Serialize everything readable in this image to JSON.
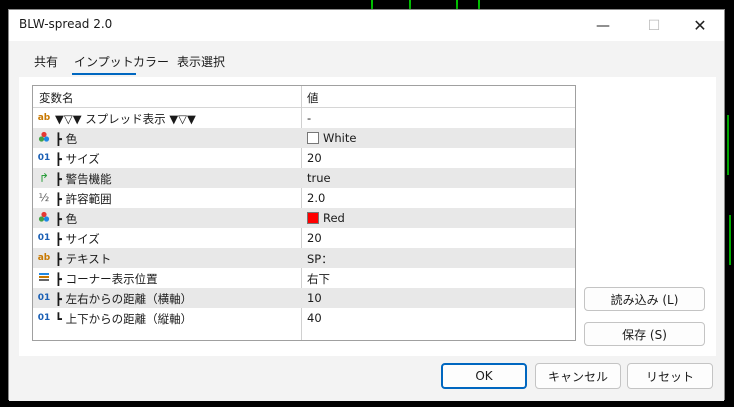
{
  "window": {
    "title": "BLW-spread 2.0",
    "minimize_glyph": "—",
    "maximize_glyph": "☐",
    "close_glyph": "✕"
  },
  "tabs": [
    {
      "label": "共有",
      "active": false
    },
    {
      "label": "インプット",
      "active": true
    },
    {
      "label": "カラー",
      "active": false
    },
    {
      "label": "表示選択",
      "active": false
    }
  ],
  "grid": {
    "headers": {
      "name": "変数名",
      "value": "値"
    },
    "rows": [
      {
        "icon": "ab",
        "icon_name": "text-type-icon",
        "name": "▼▽▼ スプレッド表示 ▼▽▼",
        "value": "-",
        "shade": false
      },
      {
        "icon": "●",
        "icon_name": "color-type-icon",
        "name": "┣ 色",
        "value": "White",
        "swatch": "#ffffff",
        "shade": true
      },
      {
        "icon": "01",
        "icon_name": "integer-type-icon",
        "name": "┣ サイズ",
        "value": "20",
        "shade": false
      },
      {
        "icon": "↱",
        "icon_name": "bool-type-icon",
        "name": "┣ 警告機能",
        "value": "true",
        "shade": true
      },
      {
        "icon": "½",
        "icon_name": "double-type-icon",
        "name": "┣ 許容範囲",
        "value": "2.0",
        "shade": false
      },
      {
        "icon": "●",
        "icon_name": "color-type-icon",
        "name": "┣ 色",
        "value": "Red",
        "swatch": "#ff0000",
        "shade": true
      },
      {
        "icon": "01",
        "icon_name": "integer-type-icon",
        "name": "┣ サイズ",
        "value": "20",
        "shade": false
      },
      {
        "icon": "ab",
        "icon_name": "text-type-icon",
        "name": "┣ テキスト",
        "value": "SP：",
        "shade": true
      },
      {
        "icon": "≡",
        "icon_name": "enum-type-icon",
        "name": "┣ コーナー表示位置",
        "value": "右下",
        "shade": false
      },
      {
        "icon": "01",
        "icon_name": "integer-type-icon",
        "name": "┣ 左右からの距離（横軸）",
        "value": "10",
        "shade": true
      },
      {
        "icon": "01",
        "icon_name": "integer-type-icon",
        "name": "┗ 上下からの距離（縦軸）",
        "value": "40",
        "shade": false
      }
    ]
  },
  "side_buttons": {
    "load": "読み込み (L)",
    "save": "保存 (S)"
  },
  "footer": {
    "ok": "OK",
    "cancel": "キャンセル",
    "reset": "リセット"
  },
  "colors": {
    "accent": "#0067c0",
    "row_shade": "#e8e8e8",
    "chart_bg": "#000000",
    "chart_green": "#00c800"
  }
}
